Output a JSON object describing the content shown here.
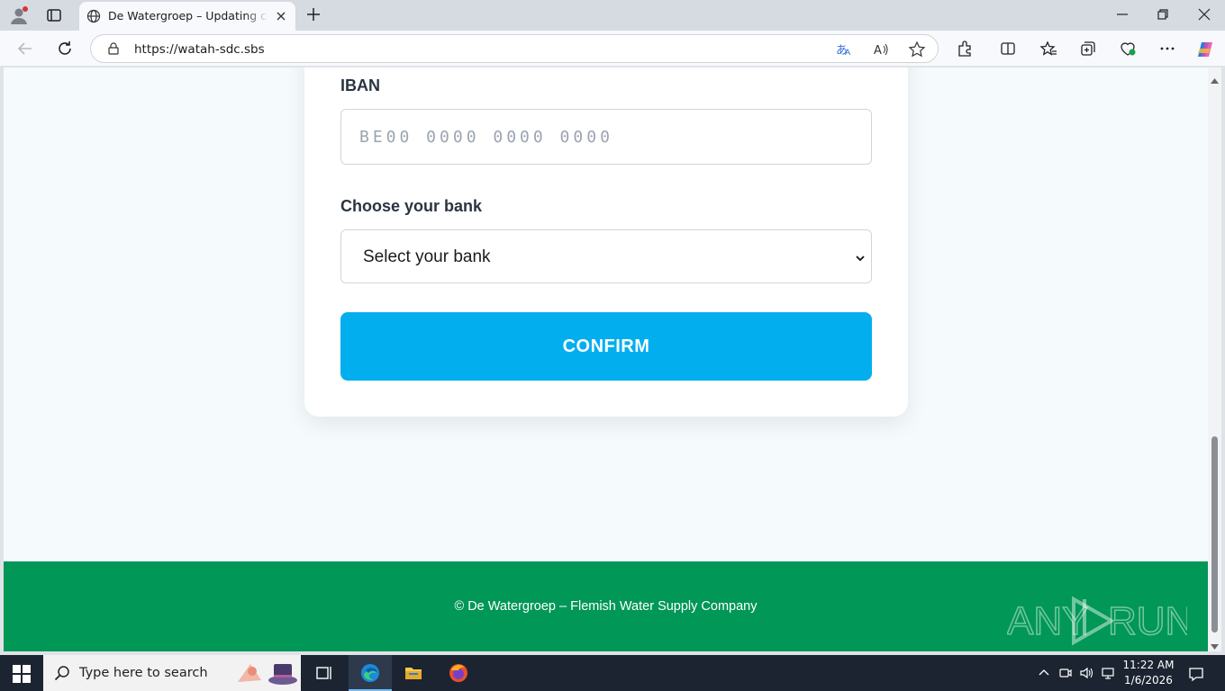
{
  "browser": {
    "tab_title": "De Watergroep – Updating customer",
    "url": "https://watah-sdc.sbs"
  },
  "form": {
    "iban_label": "IBAN",
    "iban_placeholder": "BE00 0000 0000 0000",
    "bank_label": "Choose your bank",
    "bank_select_value": "Select your bank",
    "confirm_label": "CONFIRM"
  },
  "footer": {
    "text": "© De Watergroep – Flemish Water Supply Company",
    "watermark": "ANY RUN"
  },
  "taskbar": {
    "search_placeholder": "Type here to search",
    "time": "11:22 AM",
    "date": "1/6/2026"
  },
  "colors": {
    "confirm_button": "#03aeef",
    "footer_bg": "#009757",
    "page_bg": "#f5fafd"
  }
}
